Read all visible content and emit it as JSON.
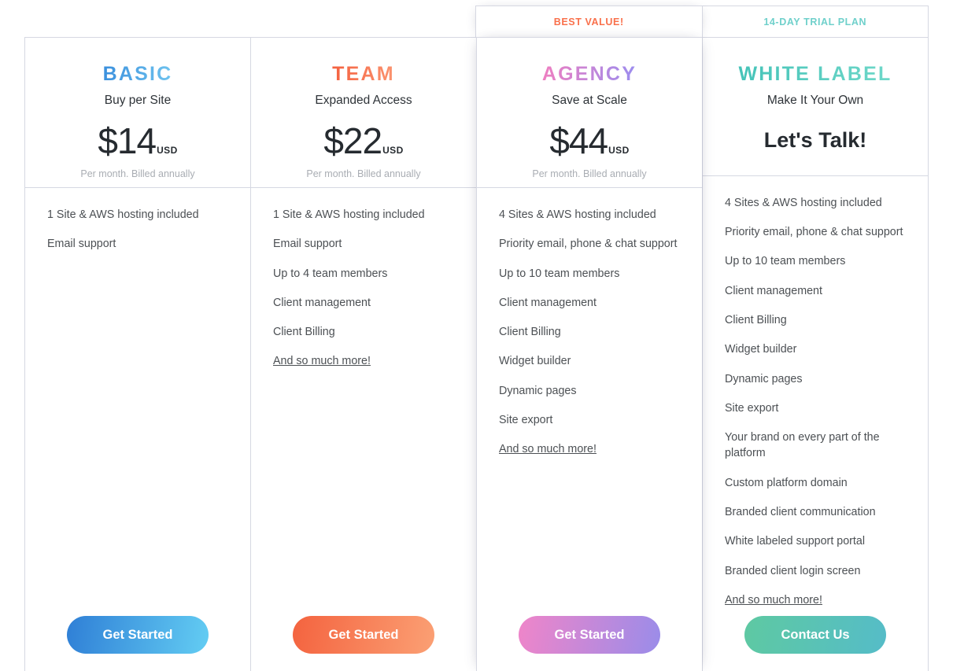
{
  "banners": [
    {
      "label": "",
      "shown": false
    },
    {
      "label": "",
      "shown": false
    },
    {
      "label": "BEST VALUE!",
      "shown": true,
      "color": "#f9704b"
    },
    {
      "label": "14-DAY TRIAL PLAN",
      "shown": true,
      "color": "#6fd0cb"
    }
  ],
  "plans": [
    {
      "name": "BASIC",
      "tagline": "Buy per Site",
      "price_amount": "$14",
      "price_currency": "USD",
      "price_note": "Per month. Billed annually",
      "features": [
        "1 Site & AWS hosting included",
        "Email support"
      ],
      "more_label": "",
      "cta_label": "Get Started",
      "accent_from": "#3a8fdd",
      "accent_to": "#6fc4ef"
    },
    {
      "name": "TEAM",
      "tagline": "Expanded Access",
      "price_amount": "$22",
      "price_currency": "USD",
      "price_note": "Per month. Billed annually",
      "features": [
        "1 Site & AWS hosting included",
        "Email support",
        "Up to 4 team members",
        "Client management",
        "Client Billing"
      ],
      "more_label": "And so much more!",
      "cta_label": "Get Started",
      "accent_from": "#f4603f",
      "accent_to": "#fb9571"
    },
    {
      "name": "AGENCY",
      "tagline": "Save at Scale",
      "price_amount": "$44",
      "price_currency": "USD",
      "price_note": "Per month. Billed annually",
      "features": [
        "4 Sites & AWS hosting included",
        "Priority email, phone & chat support",
        "Up to 10 team members",
        "Client management",
        "Client Billing",
        "Widget builder",
        "Dynamic pages",
        "Site export"
      ],
      "more_label": "And so much more!",
      "cta_label": "Get Started",
      "accent_from": "#ef7ec0",
      "accent_to": "#9a8df0"
    },
    {
      "name": "WHITE LABEL",
      "tagline": "Make It Your Own",
      "price_custom": "Let's Talk!",
      "features": [
        "4 Sites & AWS hosting included",
        "Priority email, phone & chat support",
        "Up to 10 team members",
        "Client management",
        "Client Billing",
        "Widget builder",
        "Dynamic pages",
        "Site export",
        "Your brand on every part of the platform",
        "Custom platform domain",
        "Branded client communication",
        "White labeled support portal",
        "Branded client login screen"
      ],
      "more_label": "And so much more!",
      "cta_label": "Contact Us",
      "accent_from": "#45c3b8",
      "accent_to": "#6fd8c9"
    }
  ]
}
